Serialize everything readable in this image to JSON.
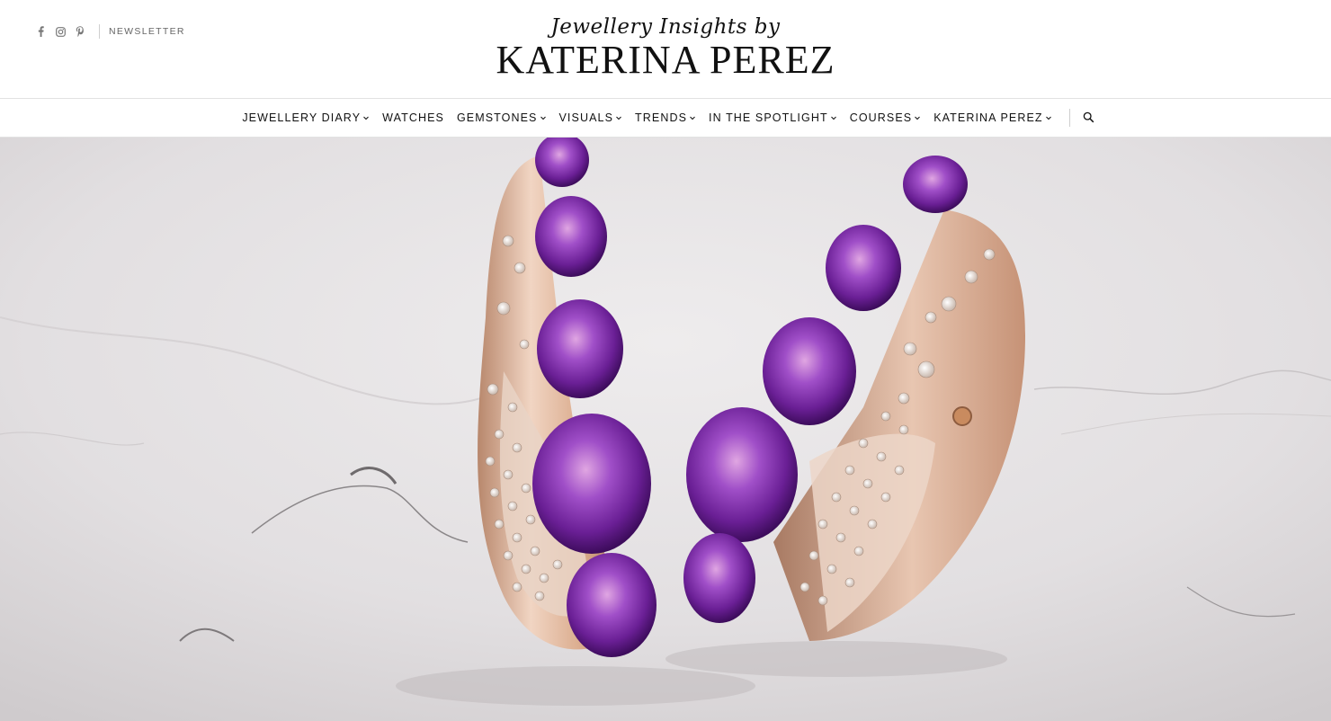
{
  "header": {
    "social_icons": [
      "facebook-icon",
      "instagram-icon",
      "pinterest-icon"
    ],
    "newsletter_label": "NEWSLETTER",
    "logo_script": "Jewellery Insights by",
    "logo_main": "KATERINA PEREZ"
  },
  "nav": {
    "items": [
      {
        "label": "JEWELLERY DIARY",
        "has_dropdown": true
      },
      {
        "label": "WATCHES",
        "has_dropdown": false
      },
      {
        "label": "GEMSTONES",
        "has_dropdown": true
      },
      {
        "label": "VISUALS",
        "has_dropdown": true
      },
      {
        "label": "TRENDS",
        "has_dropdown": true
      },
      {
        "label": "IN THE SPOTLIGHT",
        "has_dropdown": true
      },
      {
        "label": "COURSES",
        "has_dropdown": true
      },
      {
        "label": "KATERINA PEREZ",
        "has_dropdown": true
      }
    ],
    "search_icon": "search-icon"
  },
  "hero": {
    "image": "amethyst-diamond-earrings-photo",
    "colors": {
      "marble": "#e4e1e2",
      "gold": "#d9a98a",
      "amethyst": "#7a2fa8"
    }
  }
}
